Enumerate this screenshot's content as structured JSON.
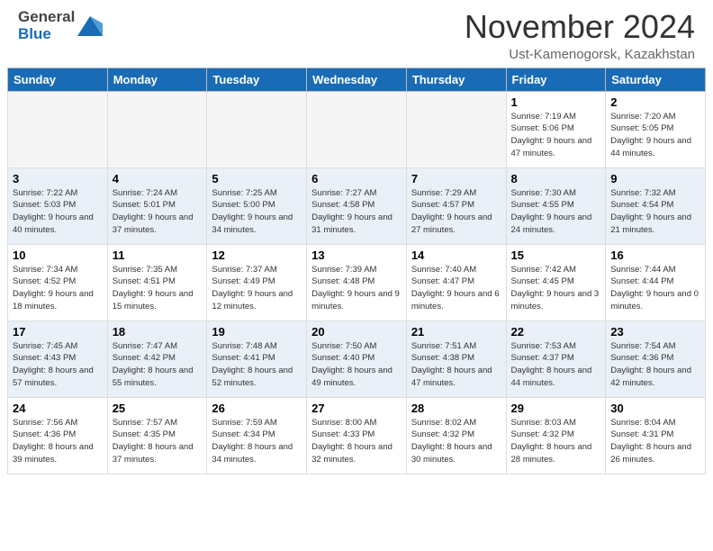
{
  "header": {
    "logo_general": "General",
    "logo_blue": "Blue",
    "month_title": "November 2024",
    "location": "Ust-Kamenogorsk, Kazakhstan"
  },
  "calendar": {
    "headers": [
      "Sunday",
      "Monday",
      "Tuesday",
      "Wednesday",
      "Thursday",
      "Friday",
      "Saturday"
    ],
    "weeks": [
      [
        {
          "day": "",
          "empty": true
        },
        {
          "day": "",
          "empty": true
        },
        {
          "day": "",
          "empty": true
        },
        {
          "day": "",
          "empty": true
        },
        {
          "day": "",
          "empty": true
        },
        {
          "day": "1",
          "sunrise": "Sunrise: 7:19 AM",
          "sunset": "Sunset: 5:06 PM",
          "daylight": "Daylight: 9 hours and 47 minutes."
        },
        {
          "day": "2",
          "sunrise": "Sunrise: 7:20 AM",
          "sunset": "Sunset: 5:05 PM",
          "daylight": "Daylight: 9 hours and 44 minutes."
        }
      ],
      [
        {
          "day": "3",
          "sunrise": "Sunrise: 7:22 AM",
          "sunset": "Sunset: 5:03 PM",
          "daylight": "Daylight: 9 hours and 40 minutes."
        },
        {
          "day": "4",
          "sunrise": "Sunrise: 7:24 AM",
          "sunset": "Sunset: 5:01 PM",
          "daylight": "Daylight: 9 hours and 37 minutes."
        },
        {
          "day": "5",
          "sunrise": "Sunrise: 7:25 AM",
          "sunset": "Sunset: 5:00 PM",
          "daylight": "Daylight: 9 hours and 34 minutes."
        },
        {
          "day": "6",
          "sunrise": "Sunrise: 7:27 AM",
          "sunset": "Sunset: 4:58 PM",
          "daylight": "Daylight: 9 hours and 31 minutes."
        },
        {
          "day": "7",
          "sunrise": "Sunrise: 7:29 AM",
          "sunset": "Sunset: 4:57 PM",
          "daylight": "Daylight: 9 hours and 27 minutes."
        },
        {
          "day": "8",
          "sunrise": "Sunrise: 7:30 AM",
          "sunset": "Sunset: 4:55 PM",
          "daylight": "Daylight: 9 hours and 24 minutes."
        },
        {
          "day": "9",
          "sunrise": "Sunrise: 7:32 AM",
          "sunset": "Sunset: 4:54 PM",
          "daylight": "Daylight: 9 hours and 21 minutes."
        }
      ],
      [
        {
          "day": "10",
          "sunrise": "Sunrise: 7:34 AM",
          "sunset": "Sunset: 4:52 PM",
          "daylight": "Daylight: 9 hours and 18 minutes."
        },
        {
          "day": "11",
          "sunrise": "Sunrise: 7:35 AM",
          "sunset": "Sunset: 4:51 PM",
          "daylight": "Daylight: 9 hours and 15 minutes."
        },
        {
          "day": "12",
          "sunrise": "Sunrise: 7:37 AM",
          "sunset": "Sunset: 4:49 PM",
          "daylight": "Daylight: 9 hours and 12 minutes."
        },
        {
          "day": "13",
          "sunrise": "Sunrise: 7:39 AM",
          "sunset": "Sunset: 4:48 PM",
          "daylight": "Daylight: 9 hours and 9 minutes."
        },
        {
          "day": "14",
          "sunrise": "Sunrise: 7:40 AM",
          "sunset": "Sunset: 4:47 PM",
          "daylight": "Daylight: 9 hours and 6 minutes."
        },
        {
          "day": "15",
          "sunrise": "Sunrise: 7:42 AM",
          "sunset": "Sunset: 4:45 PM",
          "daylight": "Daylight: 9 hours and 3 minutes."
        },
        {
          "day": "16",
          "sunrise": "Sunrise: 7:44 AM",
          "sunset": "Sunset: 4:44 PM",
          "daylight": "Daylight: 9 hours and 0 minutes."
        }
      ],
      [
        {
          "day": "17",
          "sunrise": "Sunrise: 7:45 AM",
          "sunset": "Sunset: 4:43 PM",
          "daylight": "Daylight: 8 hours and 57 minutes."
        },
        {
          "day": "18",
          "sunrise": "Sunrise: 7:47 AM",
          "sunset": "Sunset: 4:42 PM",
          "daylight": "Daylight: 8 hours and 55 minutes."
        },
        {
          "day": "19",
          "sunrise": "Sunrise: 7:48 AM",
          "sunset": "Sunset: 4:41 PM",
          "daylight": "Daylight: 8 hours and 52 minutes."
        },
        {
          "day": "20",
          "sunrise": "Sunrise: 7:50 AM",
          "sunset": "Sunset: 4:40 PM",
          "daylight": "Daylight: 8 hours and 49 minutes."
        },
        {
          "day": "21",
          "sunrise": "Sunrise: 7:51 AM",
          "sunset": "Sunset: 4:38 PM",
          "daylight": "Daylight: 8 hours and 47 minutes."
        },
        {
          "day": "22",
          "sunrise": "Sunrise: 7:53 AM",
          "sunset": "Sunset: 4:37 PM",
          "daylight": "Daylight: 8 hours and 44 minutes."
        },
        {
          "day": "23",
          "sunrise": "Sunrise: 7:54 AM",
          "sunset": "Sunset: 4:36 PM",
          "daylight": "Daylight: 8 hours and 42 minutes."
        }
      ],
      [
        {
          "day": "24",
          "sunrise": "Sunrise: 7:56 AM",
          "sunset": "Sunset: 4:36 PM",
          "daylight": "Daylight: 8 hours and 39 minutes."
        },
        {
          "day": "25",
          "sunrise": "Sunrise: 7:57 AM",
          "sunset": "Sunset: 4:35 PM",
          "daylight": "Daylight: 8 hours and 37 minutes."
        },
        {
          "day": "26",
          "sunrise": "Sunrise: 7:59 AM",
          "sunset": "Sunset: 4:34 PM",
          "daylight": "Daylight: 8 hours and 34 minutes."
        },
        {
          "day": "27",
          "sunrise": "Sunrise: 8:00 AM",
          "sunset": "Sunset: 4:33 PM",
          "daylight": "Daylight: 8 hours and 32 minutes."
        },
        {
          "day": "28",
          "sunrise": "Sunrise: 8:02 AM",
          "sunset": "Sunset: 4:32 PM",
          "daylight": "Daylight: 8 hours and 30 minutes."
        },
        {
          "day": "29",
          "sunrise": "Sunrise: 8:03 AM",
          "sunset": "Sunset: 4:32 PM",
          "daylight": "Daylight: 8 hours and 28 minutes."
        },
        {
          "day": "30",
          "sunrise": "Sunrise: 8:04 AM",
          "sunset": "Sunset: 4:31 PM",
          "daylight": "Daylight: 8 hours and 26 minutes."
        }
      ]
    ]
  }
}
